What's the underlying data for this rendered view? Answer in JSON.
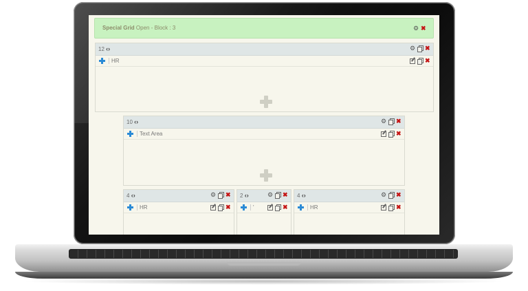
{
  "grid_header": {
    "title": "Special Grid",
    "subtitle": "Open - Block : 3"
  },
  "colors": {
    "header_bg": "#c8f2c0",
    "panel_head_bg": "#dfe6e6",
    "move_icon": "#2a8ad6",
    "delete_icon": "#c51414"
  },
  "panels": [
    {
      "width_value": "12",
      "row_label": "HR"
    },
    {
      "width_value": "10",
      "row_label": "Text Area"
    },
    {
      "width_value": "4",
      "row_label": "HR"
    },
    {
      "width_value": "2",
      "row_label": "'"
    },
    {
      "width_value": "4",
      "row_label": "HR"
    }
  ],
  "icons": {
    "settings": "gear-icon",
    "copy": "copy-icon",
    "delete": "close-icon",
    "edit": "edit-icon",
    "move": "move-icon",
    "add": "plus-icon",
    "decrease": "chevron-left-icon",
    "increase": "chevron-right-icon"
  }
}
